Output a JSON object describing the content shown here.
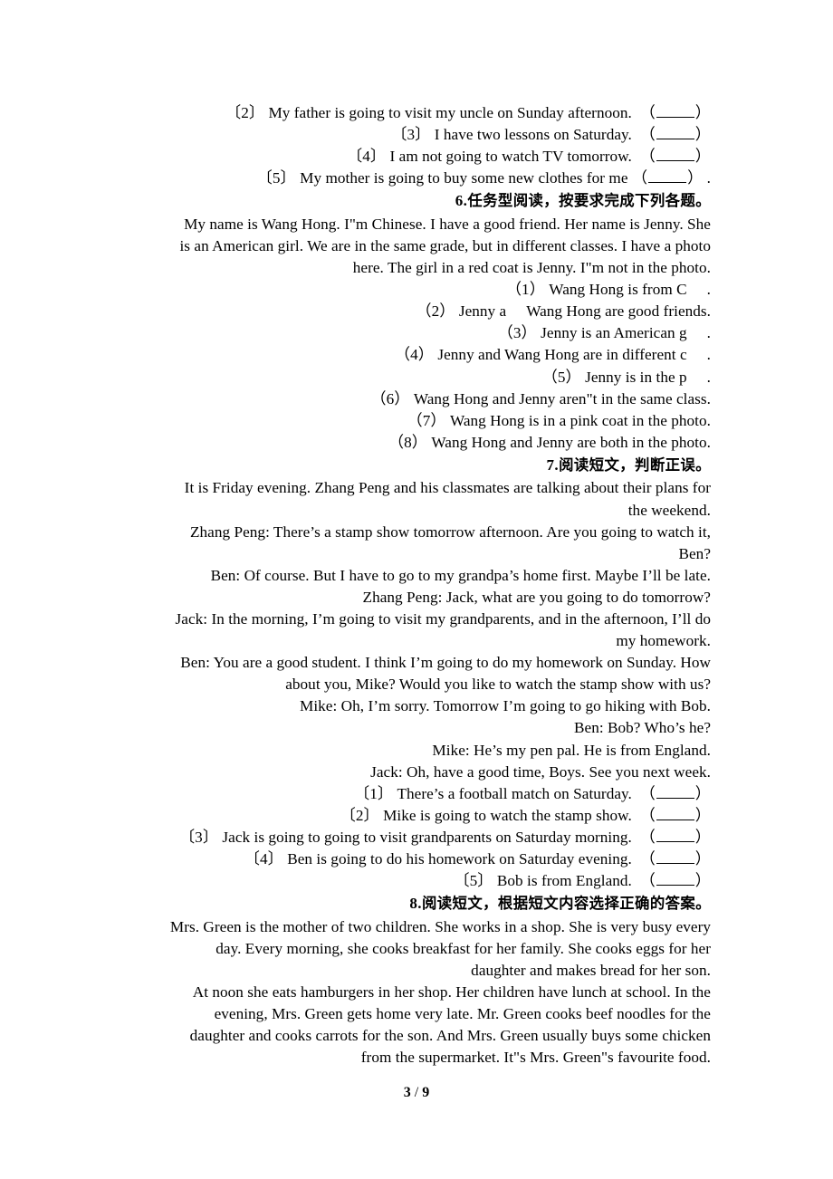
{
  "document": {
    "footer": {
      "current_page": "3",
      "separator": "/",
      "total_pages": "9"
    }
  },
  "section5_tail": {
    "items": [
      {
        "marker": "〔2〕",
        "text": "My father is going to visit my uncle on Sunday afternoon.",
        "trailing": ""
      },
      {
        "marker": "〔3〕",
        "text": "I have two lessons on Saturday.",
        "trailing": ""
      },
      {
        "marker": "〔4〕",
        "text": "I am not going to watch TV tomorrow.",
        "trailing": ""
      },
      {
        "marker": "〔5〕",
        "text": "My mother is going to buy some new clothes for me",
        "trailing": "."
      }
    ]
  },
  "section6": {
    "heading_number": "6.",
    "heading_text": "任务型阅读，按要求完成下列各题。",
    "passage_lines": [
      "My name is Wang Hong. I\"m Chinese. I have a good friend. Her name is Jenny. She",
      "is an American girl. We are in the same grade, but in different classes. I have a photo",
      "here. The girl in a red coat is Jenny. I\"m not in the photo."
    ],
    "questions": [
      {
        "marker": "（1）",
        "before": "Wang Hong is from C",
        "after": "."
      },
      {
        "marker": "（2）",
        "before": "Jenny a",
        "mid": "Wang Hong are good friends.",
        "after": ""
      },
      {
        "marker": "（3）",
        "before": "Jenny is an American g",
        "after": "."
      },
      {
        "marker": "（4）",
        "before": "Jenny and Wang Hong are in different c",
        "after": "."
      },
      {
        "marker": "（5）",
        "before": "Jenny is in the p",
        "after": "."
      },
      {
        "marker": "（6）",
        "before": "Wang Hong and Jenny aren\"t in the same class.",
        "after": ""
      },
      {
        "marker": "（7）",
        "before": "Wang Hong is in a pink coat in the photo.",
        "after": ""
      },
      {
        "marker": "（8）",
        "before": "Wang Hong and Jenny are both in the photo.",
        "after": ""
      }
    ]
  },
  "section7": {
    "heading_number": "7.",
    "heading_text": "阅读短文，判断正误。",
    "intro_lines": [
      "It is Friday evening. Zhang Peng and his classmates are talking about their plans for",
      "the weekend."
    ],
    "dialogue_lines": [
      "Zhang Peng: There’s a stamp show tomorrow afternoon. Are you going to watch it,",
      "Ben?",
      "Ben: Of course. But I have to go to my grandpa’s home first. Maybe I’ll be late.",
      "Zhang Peng: Jack, what are you going to do tomorrow?",
      "Jack: In the morning, I’m going to visit my grandparents, and in the afternoon, I’ll do",
      "my homework.",
      "Ben: You are a good student. I think I’m going to do my homework on Sunday. How",
      "about you, Mike? Would you like to watch the stamp show with us?",
      "Mike: Oh, I’m sorry. Tomorrow I’m going to go hiking with Bob.",
      "Ben: Bob? Who’s he?",
      "Mike: He’s my pen pal. He is from England.",
      "Jack: Oh, have a good time, Boys. See you next week."
    ],
    "items": [
      {
        "marker": "〔1〕",
        "text": "There’s a football match on Saturday."
      },
      {
        "marker": "〔2〕",
        "text": "Mike is going to watch the stamp show."
      },
      {
        "marker": "〔3〕",
        "text": "Jack is going to going to visit grandparents on Saturday morning."
      },
      {
        "marker": "〔4〕",
        "text": "Ben is going to do his homework on Saturday evening."
      },
      {
        "marker": "〔5〕",
        "text": "Bob is from England."
      }
    ]
  },
  "section8": {
    "heading_number": "8.",
    "heading_text": "阅读短文，根据短文内容选择正确的答案。",
    "passage_lines": [
      "Mrs. Green is the mother of two children. She works in a shop. She is very busy every",
      "day. Every morning, she cooks breakfast for her family. She cooks eggs for her",
      "daughter and makes bread for her son.",
      "At noon she eats hamburgers in her shop. Her children have lunch at school. In the",
      "evening, Mrs. Green gets home very late. Mr. Green cooks beef noodles for the",
      "daughter and cooks carrots for the son. And Mrs. Green usually buys some chicken",
      "from the supermarket. It\"s Mrs. Green\"s favourite food."
    ]
  }
}
